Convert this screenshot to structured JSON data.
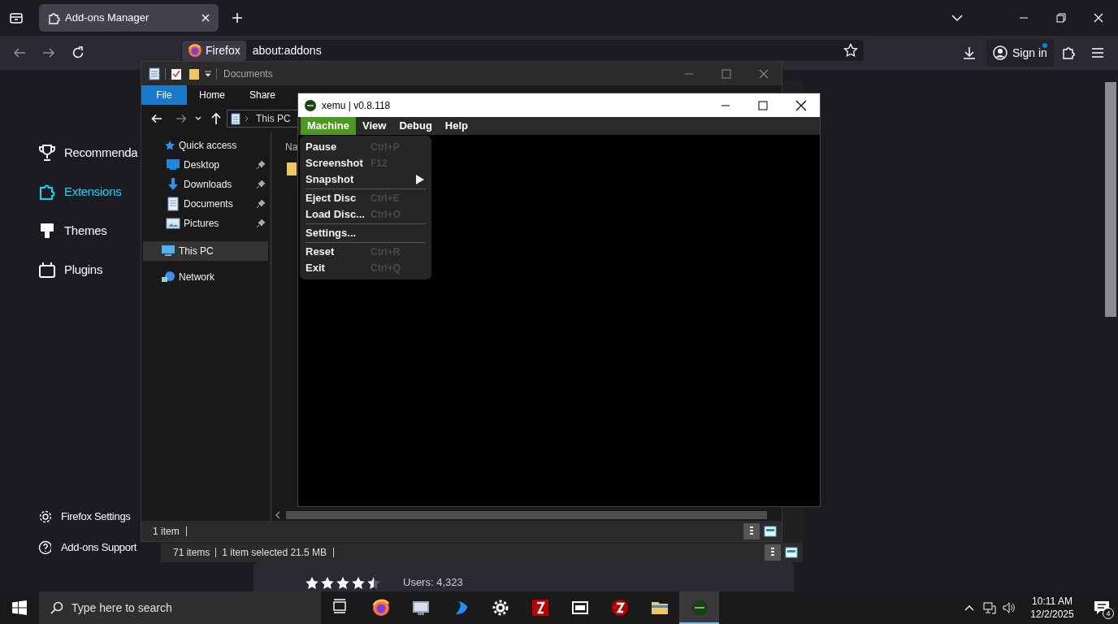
{
  "browser": {
    "tabs": [
      {
        "title": "Add-ons Manager",
        "selected": true
      }
    ],
    "identity": "Firefox",
    "url": "about:addons",
    "sign_in": "Sign in",
    "sign_in_badge": true
  },
  "addons_sidebar": {
    "categories": [
      {
        "label": "Recommenda",
        "selected": false
      },
      {
        "label": "Extensions",
        "selected": true
      },
      {
        "label": "Themes",
        "selected": false
      },
      {
        "label": "Plugins",
        "selected": false
      }
    ],
    "footer": [
      "Firefox Settings",
      "Add-ons Support"
    ]
  },
  "addon_card": {
    "stars": 4.5,
    "users": "Users: 4,323"
  },
  "explorer": {
    "title": "Documents",
    "ribbon_tabs": [
      {
        "label": "File",
        "selected": true
      },
      {
        "label": "Home",
        "selected": false
      },
      {
        "label": "Share",
        "selected": false
      }
    ],
    "breadcrumb": "This PC",
    "column_header": "Na",
    "nav": [
      {
        "label": "Quick access",
        "selected": false,
        "children": [
          {
            "label": "Desktop",
            "pinned": true
          },
          {
            "label": "Downloads",
            "pinned": true
          },
          {
            "label": "Documents",
            "pinned": true
          },
          {
            "label": "Pictures",
            "pinned": true
          }
        ]
      },
      {
        "label": "This PC",
        "selected": true
      },
      {
        "label": "Network",
        "selected": false
      }
    ],
    "status": "1 item"
  },
  "explorer_behind": {
    "status": [
      "71 items",
      "1 item selected  21.5 MB"
    ]
  },
  "xemu": {
    "title": "xemu | v0.8.118",
    "menus": [
      {
        "label": "Machine",
        "selected": true
      },
      {
        "label": "View",
        "selected": false
      },
      {
        "label": "Debug",
        "selected": false
      },
      {
        "label": "Help",
        "selected": false
      }
    ],
    "machine_menu": [
      {
        "kind": "item",
        "label": "Pause",
        "shortcut": "Ctrl+P"
      },
      {
        "kind": "item",
        "label": "Screenshot",
        "shortcut": "F12"
      },
      {
        "kind": "submenu",
        "label": "Snapshot"
      },
      {
        "kind": "separator"
      },
      {
        "kind": "item",
        "label": "Eject Disc",
        "shortcut": "Ctrl+E"
      },
      {
        "kind": "item",
        "label": "Load Disc...",
        "shortcut": "Ctrl+O"
      },
      {
        "kind": "separator"
      },
      {
        "kind": "item",
        "label": "Settings..."
      },
      {
        "kind": "separator"
      },
      {
        "kind": "item",
        "label": "Reset",
        "shortcut": "Ctrl+R"
      },
      {
        "kind": "item",
        "label": "Exit",
        "shortcut": "Ctrl+Q"
      }
    ]
  },
  "taskbar": {
    "search_placeholder": "Type here to search",
    "time": "10:11 AM",
    "date": "12/2/2025",
    "notifications": "4"
  }
}
